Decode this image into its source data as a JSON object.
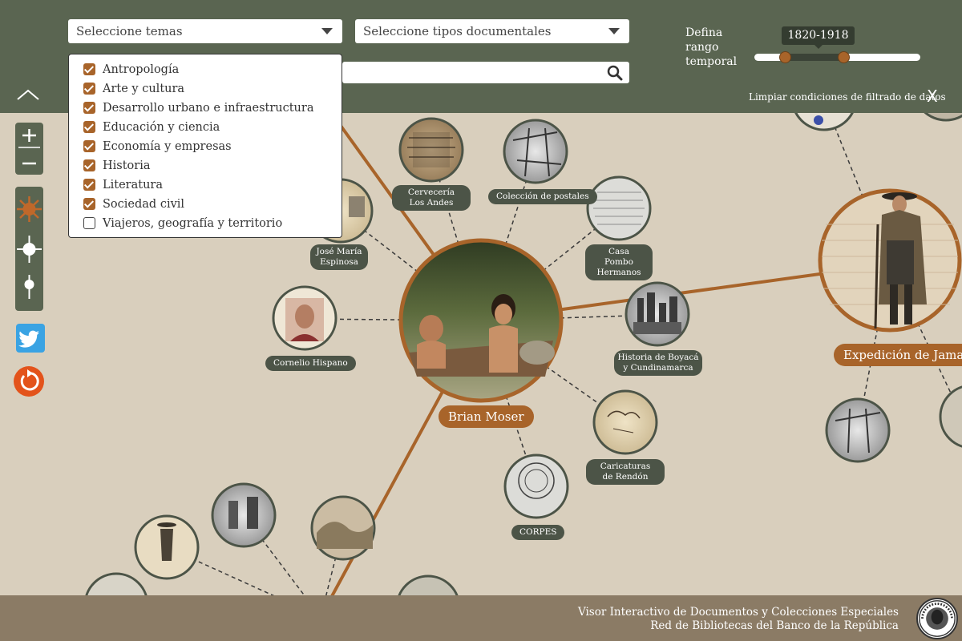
{
  "filters": {
    "themes_placeholder": "Seleccione temas",
    "doc_types_placeholder": "Seleccione tipos documentales",
    "search_value": "",
    "range_label": "Defina rango temporal",
    "range_label_lines": [
      "Defina",
      "rango",
      "temporal"
    ],
    "range_value": "1820-1918",
    "clear_filters": "Limpiar condiciones de filtrado de datos",
    "clear_x": "X"
  },
  "themes": [
    {
      "label": "Antropología",
      "checked": true
    },
    {
      "label": "Arte y cultura",
      "checked": true
    },
    {
      "label": "Desarrollo urbano e infraestructura",
      "checked": true
    },
    {
      "label": "Educación y ciencia",
      "checked": true
    },
    {
      "label": "Economía y empresas",
      "checked": true
    },
    {
      "label": "Historia",
      "checked": true
    },
    {
      "label": "Literatura",
      "checked": true
    },
    {
      "label": "Sociedad civil",
      "checked": true
    },
    {
      "label": "Viajeros, geografía y territorio",
      "checked": false
    }
  ],
  "graph": {
    "main_nodes": [
      {
        "label": "Brian Moser"
      },
      {
        "label": "Expedición de Jamaica"
      }
    ],
    "nodes": [
      {
        "label": "Cervecería Los Andes"
      },
      {
        "label": "Colección de postales"
      },
      {
        "label": "Casa Pombo Hermanos"
      },
      {
        "label": "José María Espinosa"
      },
      {
        "label": "Cornelio Hispano"
      },
      {
        "label": "Historia de Boyacá y Cundinamarca"
      },
      {
        "label": "Caricaturas de Rendón"
      },
      {
        "label": "CORPES"
      }
    ]
  },
  "footer": {
    "title": "Visor Interactivo de Documentos y Colecciones Especiales",
    "subtitle": "Red de Bibliotecas del Banco de la República",
    "logo_text": "BANCO DE LA REPÚBLICA COLOMBIA"
  },
  "colors": {
    "accent": "#a8642a",
    "bar": "#5a6551",
    "node": "#4c5447",
    "background": "#d9cfbd",
    "footer": "#8b7b65",
    "twitter": "#3aa3e3",
    "reset": "#e3531b"
  },
  "icons": [
    "search-icon",
    "caret-down-icon",
    "chevron-up-icon",
    "zoom-in-icon",
    "zoom-out-icon",
    "sun-icon",
    "target-icon",
    "dot-slider-icon",
    "twitter-icon",
    "reset-icon",
    "close-icon"
  ]
}
